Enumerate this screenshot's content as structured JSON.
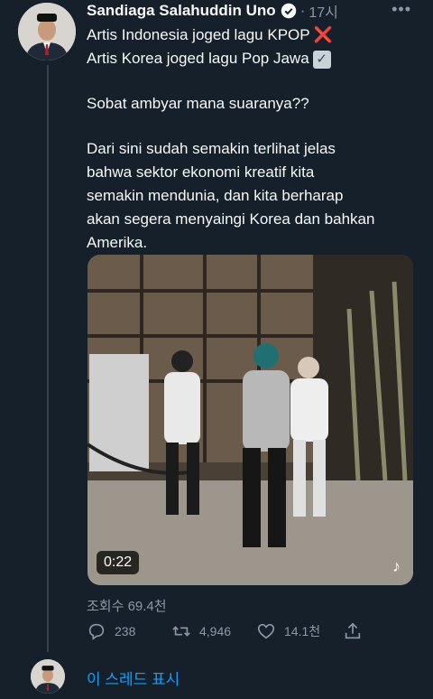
{
  "tweet": {
    "author_name": "Sandiaga Salahuddin Uno",
    "time": "17시",
    "lines": [
      "Artis Indonesia joged lagu KPOP",
      "Artis Korea joged lagu Pop Jawa",
      "Sobat ambyar mana suaranya??",
      "Dari sini sudah semakin terlihat jelas",
      "bahwa sektor ekonomi kreatif kita",
      "semakin mendunia, dan kita berharap",
      "akan segera menyaingi Korea dan bahkan",
      "Amerika."
    ],
    "emoji_cross": "❌",
    "emoji_check": "✓",
    "video_duration": "0:22",
    "views_label": "조회수 69.4천"
  },
  "actions": {
    "reply_count": "238",
    "retweet_count": "4,946",
    "like_count": "14.1천"
  },
  "thread": {
    "show_thread_label": "이 스레드 표시"
  },
  "colors": {
    "background": "#15202b",
    "text": "#f7f9f9",
    "secondary": "#8b98a5",
    "accent": "#1d9bf0"
  }
}
